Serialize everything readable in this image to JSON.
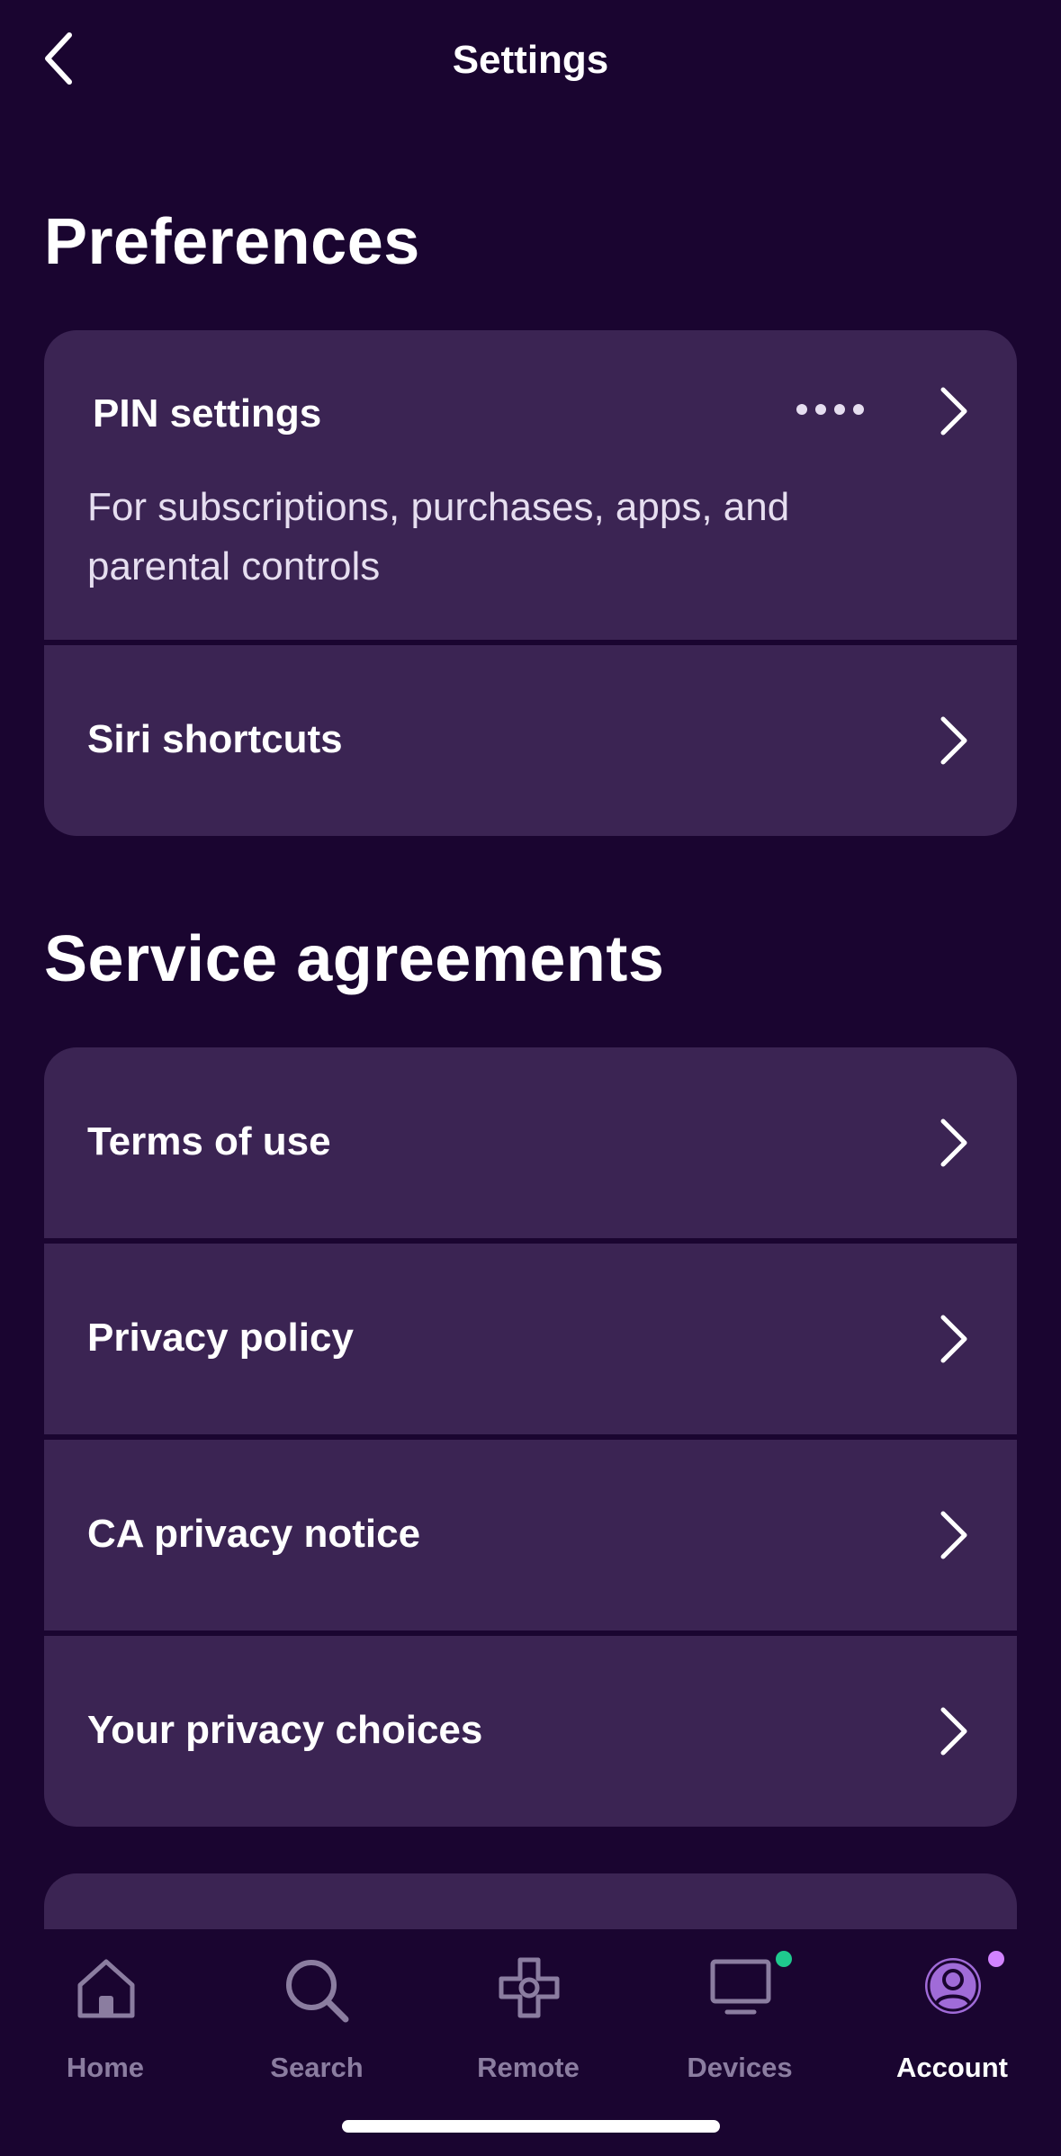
{
  "header": {
    "title": "Settings"
  },
  "preferences": {
    "title": "Preferences",
    "pin": {
      "label": "PIN settings",
      "subtitle": "For subscriptions, purchases, apps, and parental controls"
    },
    "siri": {
      "label": "Siri shortcuts"
    }
  },
  "agreements": {
    "title": "Service agreements",
    "items": [
      {
        "label": "Terms of use"
      },
      {
        "label": "Privacy policy"
      },
      {
        "label": "CA privacy notice"
      },
      {
        "label": "Your privacy choices"
      }
    ]
  },
  "tabbar": {
    "tabs": [
      {
        "label": "Home",
        "icon": "home-icon",
        "active": false
      },
      {
        "label": "Search",
        "icon": "search-icon",
        "active": false
      },
      {
        "label": "Remote",
        "icon": "remote-dpad-icon",
        "active": false
      },
      {
        "label": "Devices",
        "icon": "tv-icon",
        "active": false,
        "badge_color": "#1fc98e"
      },
      {
        "label": "Account",
        "icon": "account-icon",
        "active": true,
        "badge_color": "#d283ff"
      }
    ]
  },
  "colors": {
    "background": "#1a0530",
    "card": "#3b2453",
    "inactive_tab": "#8b7da0",
    "active_tab": "#ffffff",
    "account_accent": "#a06bd8"
  }
}
